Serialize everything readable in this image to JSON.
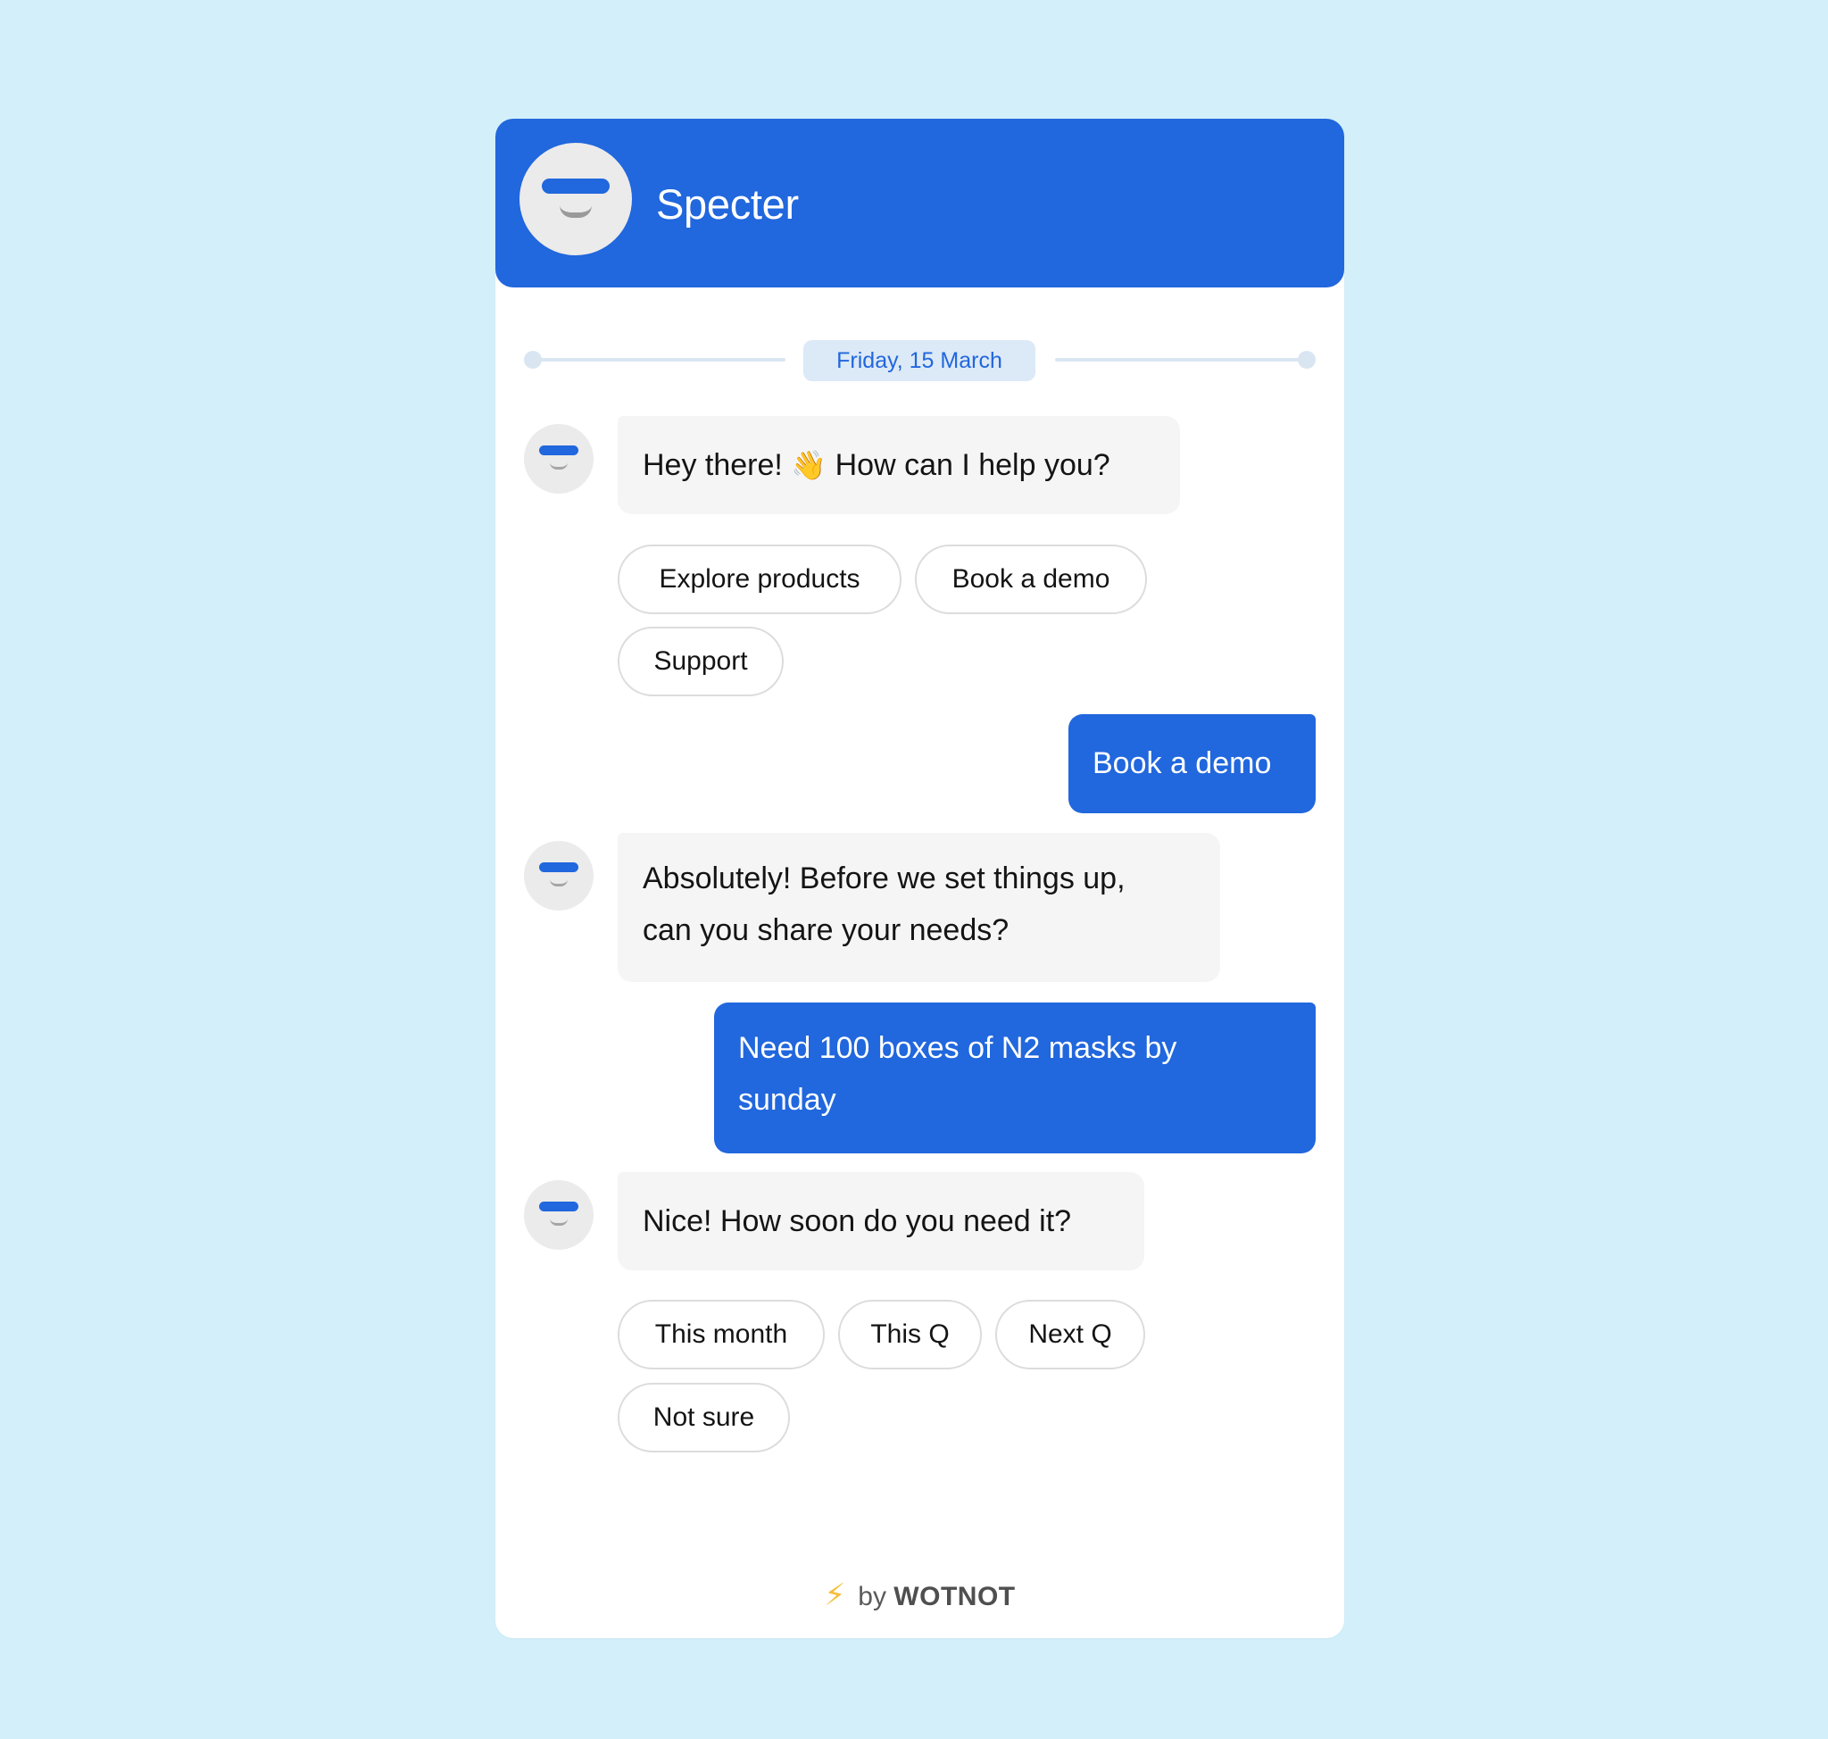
{
  "header": {
    "title": "Specter",
    "avatar_icon": "bot-face-icon"
  },
  "colors": {
    "brand": "#2167DD",
    "background": "#D3F0FA",
    "bot_bubble": "#F5F5F5",
    "date_pill": "#DCE9F7",
    "footer_bolt": "#F6BE3A"
  },
  "date_divider": {
    "label": "Friday, 15 March"
  },
  "messages": [
    {
      "sender": "bot",
      "text_before_emoji": "Hey there! ",
      "emoji": "👋",
      "text_after_emoji": " How can I help you?",
      "quick_replies": [
        "Explore products",
        "Book a demo",
        "Support"
      ]
    },
    {
      "sender": "user",
      "text": "Book a demo"
    },
    {
      "sender": "bot",
      "lines": [
        "Absolutely! Before we set things up,",
        "can you share your needs?"
      ]
    },
    {
      "sender": "user",
      "lines": [
        "Need 100 boxes of N2 masks by",
        "sunday"
      ]
    },
    {
      "sender": "bot",
      "text": "Nice! How soon do you need it?",
      "quick_replies": [
        "This month",
        "This Q",
        "Next Q",
        "Not sure"
      ]
    }
  ],
  "footer": {
    "icon": "⚡",
    "prefix": "by",
    "brand": "WOTNOT"
  }
}
